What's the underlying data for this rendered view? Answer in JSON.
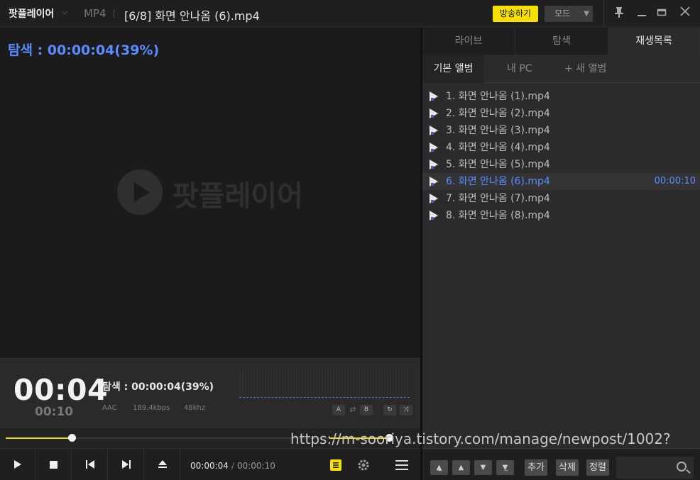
{
  "titlebar": {
    "app_name": "팟플레이어",
    "format": "MP4",
    "file_title": "[6/8] 화면 안나옴 (6).mp4",
    "broadcast_label": "방송하기",
    "mode_label": "모드",
    "pin_icon": "pin-icon",
    "minimize_icon": "minimize-icon",
    "maximize_icon": "maximize-icon",
    "close_icon": "close-icon"
  },
  "video": {
    "seek_text": "탐색 : 00:00:04(39%)",
    "watermark_text": "팟플레이어"
  },
  "info": {
    "current_time": "00:04",
    "total_time": "00:10",
    "seek_text": "탐색 : 00:00:04(39%)",
    "audio_codec": "AAC",
    "bitrate": "189.4kbps",
    "sample_rate": "48khz",
    "ab_a": "A",
    "ab_b": "B"
  },
  "progress": {
    "position_fraction": 0.39,
    "volume_fraction": 0.9
  },
  "controls": {
    "elapsed": "00:00:04",
    "separator": "/",
    "duration": "00:00:10"
  },
  "rightpanel": {
    "tabs": [
      "라이브",
      "탐색",
      "재생목록"
    ],
    "subtabs": [
      "기본 앨범",
      "내 PC",
      "+ 새 앨범"
    ],
    "playlist": [
      {
        "title": "1. 화면 안나옴 (1).mp4",
        "duration": ""
      },
      {
        "title": "2. 화면 안나옴 (2).mp4",
        "duration": ""
      },
      {
        "title": "3. 화면 안나옴 (3).mp4",
        "duration": ""
      },
      {
        "title": "4. 화면 안나옴 (4).mp4",
        "duration": ""
      },
      {
        "title": "5. 화면 안나옴 (5).mp4",
        "duration": ""
      },
      {
        "title": "6. 화면 안나옴 (6).mp4",
        "duration": "00:00:10"
      },
      {
        "title": "7. 화면 안나옴 (7).mp4",
        "duration": ""
      },
      {
        "title": "8. 화면 안나옴 (8).mp4",
        "duration": ""
      }
    ],
    "bottom": {
      "add_label": "추가",
      "delete_label": "삭제",
      "sort_label": "정렬"
    }
  },
  "overlay_url": "https://m-sooriya.tistory.com/manage/newpost/1002?",
  "colors": {
    "accent_blue": "#5a8cff",
    "accent_yellow": "#f2dc00"
  }
}
